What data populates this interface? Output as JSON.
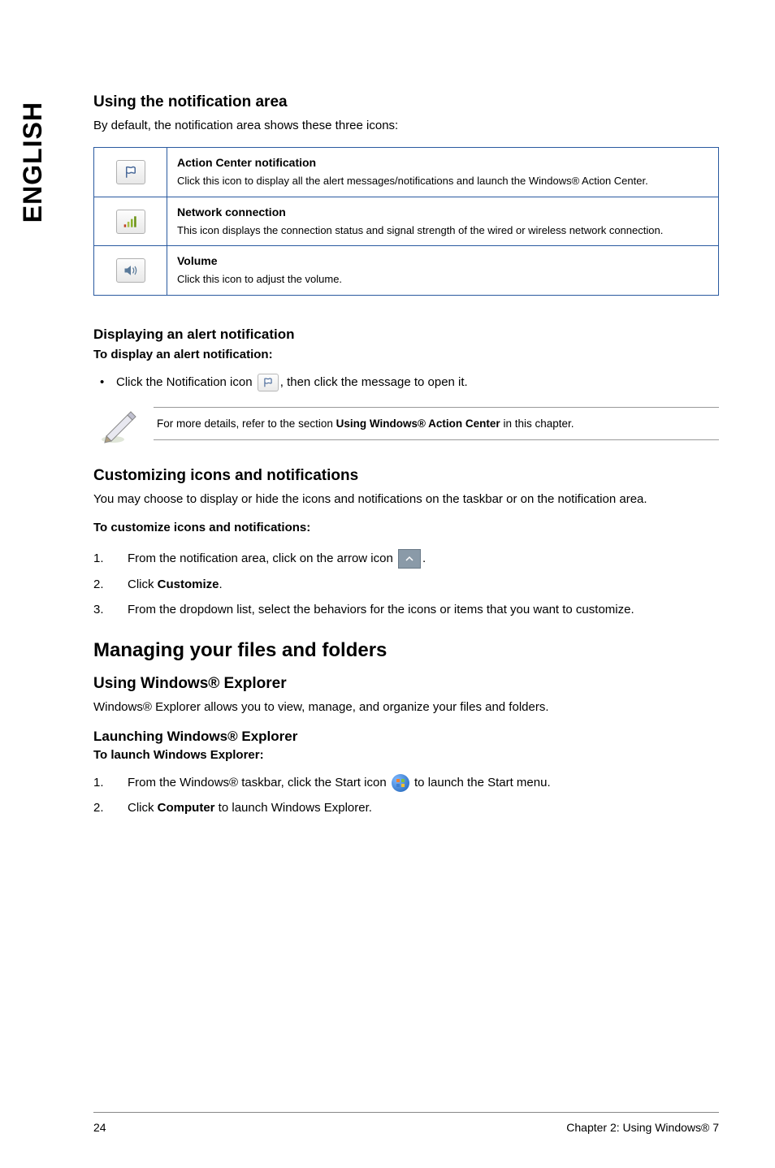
{
  "side_tab": "ENGLISH",
  "sec1": {
    "heading": "Using the notification area",
    "intro": "By default, the notification area shows these three icons:",
    "rows": [
      {
        "title": "Action Center notification",
        "desc": "Click this icon to display all the alert messages/notifications and launch the Windows® Action Center."
      },
      {
        "title": "Network connection",
        "desc": "This icon displays the connection status and signal strength of the wired or wireless network connection."
      },
      {
        "title": "Volume",
        "desc": "Click this icon to adjust the volume."
      }
    ]
  },
  "sec2": {
    "heading": "Displaying an alert notification",
    "bold": "To display an alert notification:",
    "bullet_pre": "Click the Notification icon ",
    "bullet_post": ", then click the message to open it."
  },
  "note": {
    "pre": "For more details, refer to the section ",
    "bold": "Using Windows® Action Center",
    "post": " in this chapter."
  },
  "sec3": {
    "heading": "Customizing icons and notifications",
    "intro": "You may choose to display or hide the icons and notifications on the taskbar or on the notification area.",
    "bold": "To customize icons and notifications:",
    "items": [
      {
        "num": "1.",
        "pre": "From the notification area, click on the arrow icon ",
        "post": ".",
        "has_arrow": true
      },
      {
        "num": "2.",
        "pre": "Click ",
        "bold": "Customize",
        "post": "."
      },
      {
        "num": "3.",
        "text": "From the dropdown list, select the behaviors for the icons or items that you want to customize."
      }
    ]
  },
  "sec4": {
    "h2": "Managing your files and folders",
    "sub": "Using Windows® Explorer",
    "intro": "Windows® Explorer allows you to view, manage, and organize your files and folders.",
    "sub2": "Launching Windows® Explorer",
    "bold": "To launch Windows Explorer:",
    "items": [
      {
        "num": "1.",
        "pre": "From the Windows® taskbar, click the Start icon ",
        "post": " to launch the Start menu.",
        "has_orb": true
      },
      {
        "num": "2.",
        "pre": "Click ",
        "bold": "Computer",
        "post": " to launch Windows Explorer."
      }
    ]
  },
  "footer": {
    "page": "24",
    "chapter": "Chapter 2: Using Windows® 7"
  }
}
